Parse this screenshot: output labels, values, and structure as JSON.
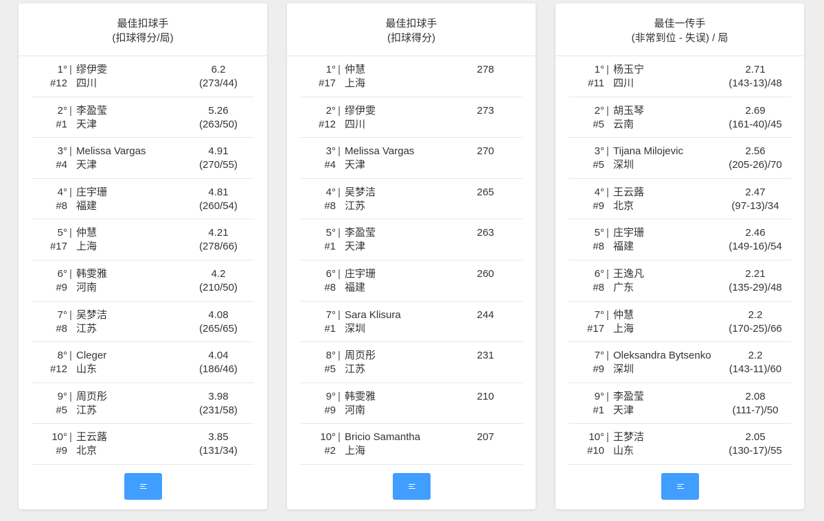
{
  "cards": [
    {
      "title": "最佳扣球手",
      "subtitle": "(扣球得分/局)",
      "rows": [
        {
          "rank": "1°",
          "name": "缪伊雯",
          "number": "#12",
          "team": "四川",
          "value": "6.2",
          "detail": "(273/44)"
        },
        {
          "rank": "2°",
          "name": "李盈莹",
          "number": "#1",
          "team": "天津",
          "value": "5.26",
          "detail": "(263/50)"
        },
        {
          "rank": "3°",
          "name": "Melissa Vargas",
          "number": "#4",
          "team": "天津",
          "value": "4.91",
          "detail": "(270/55)"
        },
        {
          "rank": "4°",
          "name": "庄宇珊",
          "number": "#8",
          "team": "福建",
          "value": "4.81",
          "detail": "(260/54)"
        },
        {
          "rank": "5°",
          "name": "仲慧",
          "number": "#17",
          "team": "上海",
          "value": "4.21",
          "detail": "(278/66)"
        },
        {
          "rank": "6°",
          "name": "韩雯雅",
          "number": "#9",
          "team": "河南",
          "value": "4.2",
          "detail": "(210/50)"
        },
        {
          "rank": "7°",
          "name": "吴梦洁",
          "number": "#8",
          "team": "江苏",
          "value": "4.08",
          "detail": "(265/65)"
        },
        {
          "rank": "8°",
          "name": "Cleger",
          "number": "#12",
          "team": "山东",
          "value": "4.04",
          "detail": "(186/46)"
        },
        {
          "rank": "9°",
          "name": "周页彤",
          "number": "#5",
          "team": "江苏",
          "value": "3.98",
          "detail": "(231/58)"
        },
        {
          "rank": "10°",
          "name": "王云蕗",
          "number": "#9",
          "team": "北京",
          "value": "3.85",
          "detail": "(131/34)"
        }
      ],
      "more_icon": "list-icon"
    },
    {
      "title": "最佳扣球手",
      "subtitle": "(扣球得分)",
      "rows": [
        {
          "rank": "1°",
          "name": "仲慧",
          "number": "#17",
          "team": "上海",
          "value": "278",
          "detail": ""
        },
        {
          "rank": "2°",
          "name": "缪伊雯",
          "number": "#12",
          "team": "四川",
          "value": "273",
          "detail": ""
        },
        {
          "rank": "3°",
          "name": "Melissa Vargas",
          "number": "#4",
          "team": "天津",
          "value": "270",
          "detail": ""
        },
        {
          "rank": "4°",
          "name": "吴梦洁",
          "number": "#8",
          "team": "江苏",
          "value": "265",
          "detail": ""
        },
        {
          "rank": "5°",
          "name": "李盈莹",
          "number": "#1",
          "team": "天津",
          "value": "263",
          "detail": ""
        },
        {
          "rank": "6°",
          "name": "庄宇珊",
          "number": "#8",
          "team": "福建",
          "value": "260",
          "detail": ""
        },
        {
          "rank": "7°",
          "name": "Sara Klisura",
          "number": "#1",
          "team": "深圳",
          "value": "244",
          "detail": ""
        },
        {
          "rank": "8°",
          "name": "周页彤",
          "number": "#5",
          "team": "江苏",
          "value": "231",
          "detail": ""
        },
        {
          "rank": "9°",
          "name": "韩雯雅",
          "number": "#9",
          "team": "河南",
          "value": "210",
          "detail": ""
        },
        {
          "rank": "10°",
          "name": "Bricio Samantha",
          "number": "#2",
          "team": "上海",
          "value": "207",
          "detail": ""
        }
      ],
      "more_icon": "list-icon"
    },
    {
      "title": "最佳一传手",
      "subtitle": "(非常到位 - 失误) / 局",
      "rows": [
        {
          "rank": "1°",
          "name": "杨玉宁",
          "number": "#11",
          "team": "四川",
          "value": "2.71",
          "detail": "(143-13)/48"
        },
        {
          "rank": "2°",
          "name": "胡玉琴",
          "number": "#5",
          "team": "云南",
          "value": "2.69",
          "detail": "(161-40)/45"
        },
        {
          "rank": "3°",
          "name": "Tijana Milojevic",
          "number": "#5",
          "team": "深圳",
          "value": "2.56",
          "detail": "(205-26)/70"
        },
        {
          "rank": "4°",
          "name": "王云蕗",
          "number": "#9",
          "team": "北京",
          "value": "2.47",
          "detail": "(97-13)/34"
        },
        {
          "rank": "5°",
          "name": "庄宇珊",
          "number": "#8",
          "team": "福建",
          "value": "2.46",
          "detail": "(149-16)/54"
        },
        {
          "rank": "6°",
          "name": "王逸凡",
          "number": "#8",
          "team": "广东",
          "value": "2.21",
          "detail": "(135-29)/48"
        },
        {
          "rank": "7°",
          "name": "仲慧",
          "number": "#17",
          "team": "上海",
          "value": "2.2",
          "detail": "(170-25)/66"
        },
        {
          "rank": "7°",
          "name": "Oleksandra Bytsenko",
          "number": "#9",
          "team": "深圳",
          "value": "2.2",
          "detail": "(143-11)/60"
        },
        {
          "rank": "9°",
          "name": "李盈莹",
          "number": "#1",
          "team": "天津",
          "value": "2.08",
          "detail": "(111-7)/50"
        },
        {
          "rank": "10°",
          "name": "王梦洁",
          "number": "#10",
          "team": "山东",
          "value": "2.05",
          "detail": "(130-17)/55"
        }
      ],
      "more_icon": "list-icon"
    }
  ],
  "colors": {
    "button": "#409eff",
    "background": "#eeeeee",
    "card": "#ffffff",
    "divider": "#e8e8e8"
  }
}
